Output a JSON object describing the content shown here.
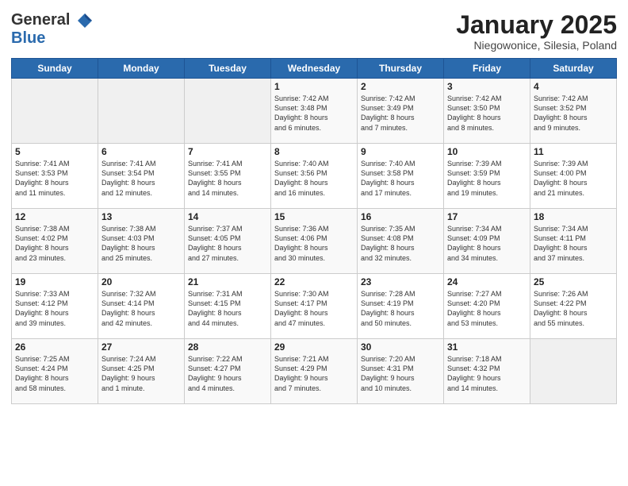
{
  "header": {
    "logo_general": "General",
    "logo_blue": "Blue",
    "month_title": "January 2025",
    "location": "Niegowonice, Silesia, Poland"
  },
  "weekdays": [
    "Sunday",
    "Monday",
    "Tuesday",
    "Wednesday",
    "Thursday",
    "Friday",
    "Saturday"
  ],
  "weeks": [
    [
      {
        "day": "",
        "text": ""
      },
      {
        "day": "",
        "text": ""
      },
      {
        "day": "",
        "text": ""
      },
      {
        "day": "1",
        "text": "Sunrise: 7:42 AM\nSunset: 3:48 PM\nDaylight: 8 hours\nand 6 minutes."
      },
      {
        "day": "2",
        "text": "Sunrise: 7:42 AM\nSunset: 3:49 PM\nDaylight: 8 hours\nand 7 minutes."
      },
      {
        "day": "3",
        "text": "Sunrise: 7:42 AM\nSunset: 3:50 PM\nDaylight: 8 hours\nand 8 minutes."
      },
      {
        "day": "4",
        "text": "Sunrise: 7:42 AM\nSunset: 3:52 PM\nDaylight: 8 hours\nand 9 minutes."
      }
    ],
    [
      {
        "day": "5",
        "text": "Sunrise: 7:41 AM\nSunset: 3:53 PM\nDaylight: 8 hours\nand 11 minutes."
      },
      {
        "day": "6",
        "text": "Sunrise: 7:41 AM\nSunset: 3:54 PM\nDaylight: 8 hours\nand 12 minutes."
      },
      {
        "day": "7",
        "text": "Sunrise: 7:41 AM\nSunset: 3:55 PM\nDaylight: 8 hours\nand 14 minutes."
      },
      {
        "day": "8",
        "text": "Sunrise: 7:40 AM\nSunset: 3:56 PM\nDaylight: 8 hours\nand 16 minutes."
      },
      {
        "day": "9",
        "text": "Sunrise: 7:40 AM\nSunset: 3:58 PM\nDaylight: 8 hours\nand 17 minutes."
      },
      {
        "day": "10",
        "text": "Sunrise: 7:39 AM\nSunset: 3:59 PM\nDaylight: 8 hours\nand 19 minutes."
      },
      {
        "day": "11",
        "text": "Sunrise: 7:39 AM\nSunset: 4:00 PM\nDaylight: 8 hours\nand 21 minutes."
      }
    ],
    [
      {
        "day": "12",
        "text": "Sunrise: 7:38 AM\nSunset: 4:02 PM\nDaylight: 8 hours\nand 23 minutes."
      },
      {
        "day": "13",
        "text": "Sunrise: 7:38 AM\nSunset: 4:03 PM\nDaylight: 8 hours\nand 25 minutes."
      },
      {
        "day": "14",
        "text": "Sunrise: 7:37 AM\nSunset: 4:05 PM\nDaylight: 8 hours\nand 27 minutes."
      },
      {
        "day": "15",
        "text": "Sunrise: 7:36 AM\nSunset: 4:06 PM\nDaylight: 8 hours\nand 30 minutes."
      },
      {
        "day": "16",
        "text": "Sunrise: 7:35 AM\nSunset: 4:08 PM\nDaylight: 8 hours\nand 32 minutes."
      },
      {
        "day": "17",
        "text": "Sunrise: 7:34 AM\nSunset: 4:09 PM\nDaylight: 8 hours\nand 34 minutes."
      },
      {
        "day": "18",
        "text": "Sunrise: 7:34 AM\nSunset: 4:11 PM\nDaylight: 8 hours\nand 37 minutes."
      }
    ],
    [
      {
        "day": "19",
        "text": "Sunrise: 7:33 AM\nSunset: 4:12 PM\nDaylight: 8 hours\nand 39 minutes."
      },
      {
        "day": "20",
        "text": "Sunrise: 7:32 AM\nSunset: 4:14 PM\nDaylight: 8 hours\nand 42 minutes."
      },
      {
        "day": "21",
        "text": "Sunrise: 7:31 AM\nSunset: 4:15 PM\nDaylight: 8 hours\nand 44 minutes."
      },
      {
        "day": "22",
        "text": "Sunrise: 7:30 AM\nSunset: 4:17 PM\nDaylight: 8 hours\nand 47 minutes."
      },
      {
        "day": "23",
        "text": "Sunrise: 7:28 AM\nSunset: 4:19 PM\nDaylight: 8 hours\nand 50 minutes."
      },
      {
        "day": "24",
        "text": "Sunrise: 7:27 AM\nSunset: 4:20 PM\nDaylight: 8 hours\nand 53 minutes."
      },
      {
        "day": "25",
        "text": "Sunrise: 7:26 AM\nSunset: 4:22 PM\nDaylight: 8 hours\nand 55 minutes."
      }
    ],
    [
      {
        "day": "26",
        "text": "Sunrise: 7:25 AM\nSunset: 4:24 PM\nDaylight: 8 hours\nand 58 minutes."
      },
      {
        "day": "27",
        "text": "Sunrise: 7:24 AM\nSunset: 4:25 PM\nDaylight: 9 hours\nand 1 minute."
      },
      {
        "day": "28",
        "text": "Sunrise: 7:22 AM\nSunset: 4:27 PM\nDaylight: 9 hours\nand 4 minutes."
      },
      {
        "day": "29",
        "text": "Sunrise: 7:21 AM\nSunset: 4:29 PM\nDaylight: 9 hours\nand 7 minutes."
      },
      {
        "day": "30",
        "text": "Sunrise: 7:20 AM\nSunset: 4:31 PM\nDaylight: 9 hours\nand 10 minutes."
      },
      {
        "day": "31",
        "text": "Sunrise: 7:18 AM\nSunset: 4:32 PM\nDaylight: 9 hours\nand 14 minutes."
      },
      {
        "day": "",
        "text": ""
      }
    ]
  ]
}
